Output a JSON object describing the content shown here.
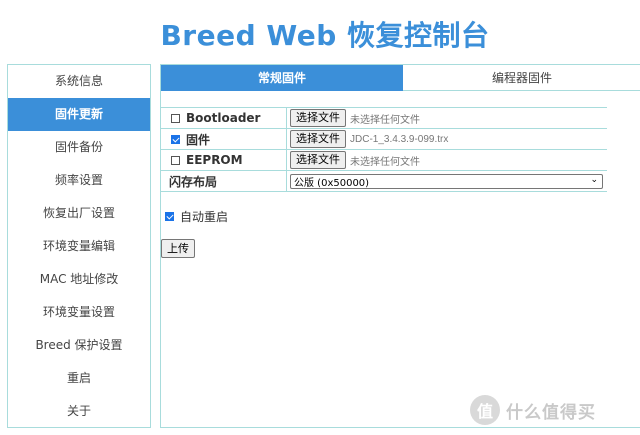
{
  "header": {
    "title": "Breed Web 恢复控制台"
  },
  "sidebar": {
    "items": [
      {
        "label": "系统信息",
        "active": false
      },
      {
        "label": "固件更新",
        "active": true
      },
      {
        "label": "固件备份",
        "active": false
      },
      {
        "label": "频率设置",
        "active": false
      },
      {
        "label": "恢复出厂设置",
        "active": false
      },
      {
        "label": "环境变量编辑",
        "active": false
      },
      {
        "label": "MAC 地址修改",
        "active": false
      },
      {
        "label": "环境变量设置",
        "active": false
      },
      {
        "label": "Breed 保护设置",
        "active": false
      },
      {
        "label": "重启",
        "active": false
      },
      {
        "label": "关于",
        "active": false
      }
    ]
  },
  "tabs": [
    {
      "label": "常规固件",
      "active": true
    },
    {
      "label": "编程器固件",
      "active": false
    }
  ],
  "form": {
    "rows": [
      {
        "label": "Bootloader",
        "checked": false,
        "button": "选择文件",
        "file_text": "未选择任何文件"
      },
      {
        "label": "固件",
        "checked": true,
        "button": "选择文件",
        "file_text": "JDC-1_3.4.3.9-099.trx"
      },
      {
        "label": "EEPROM",
        "checked": false,
        "button": "选择文件",
        "file_text": "未选择任何文件"
      }
    ],
    "layout": {
      "label": "闪存布局",
      "selected": "公版 (0x50000)"
    }
  },
  "auto_reboot": {
    "label": "自动重启",
    "checked": true
  },
  "upload_button": "上传",
  "watermark": {
    "icon_text": "值",
    "text": "什么值得买"
  },
  "colors": {
    "accent": "#3b8fd9",
    "border": "#a8dcdc"
  }
}
